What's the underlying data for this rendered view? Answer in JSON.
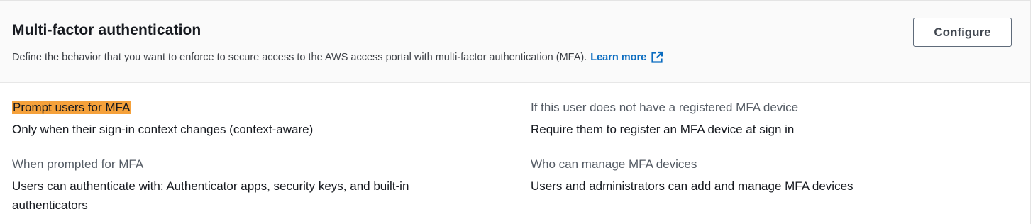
{
  "header": {
    "title": "Multi-factor authentication",
    "description": "Define the behavior that you want to enforce to secure access to the AWS access portal with multi-factor authentication (MFA).",
    "learn_more": "Learn more",
    "learn_more_icon": "external-link-icon",
    "configure_label": "Configure"
  },
  "colors": {
    "link": "#0a6cc0",
    "highlight": "#f5a13b",
    "header_bg": "#fafafa"
  },
  "left_column": [
    {
      "label": "Prompt users for MFA",
      "value": "Only when their sign-in context changes (context-aware)",
      "highlighted": true
    },
    {
      "label": "When prompted for MFA",
      "value": "Users can authenticate with: Authenticator apps, security keys, and built-in authenticators"
    }
  ],
  "right_column": [
    {
      "label": "If this user does not have a registered MFA device",
      "value": "Require them to register an MFA device at sign in"
    },
    {
      "label": "Who can manage MFA devices",
      "value": "Users and administrators can add and manage MFA devices"
    }
  ]
}
